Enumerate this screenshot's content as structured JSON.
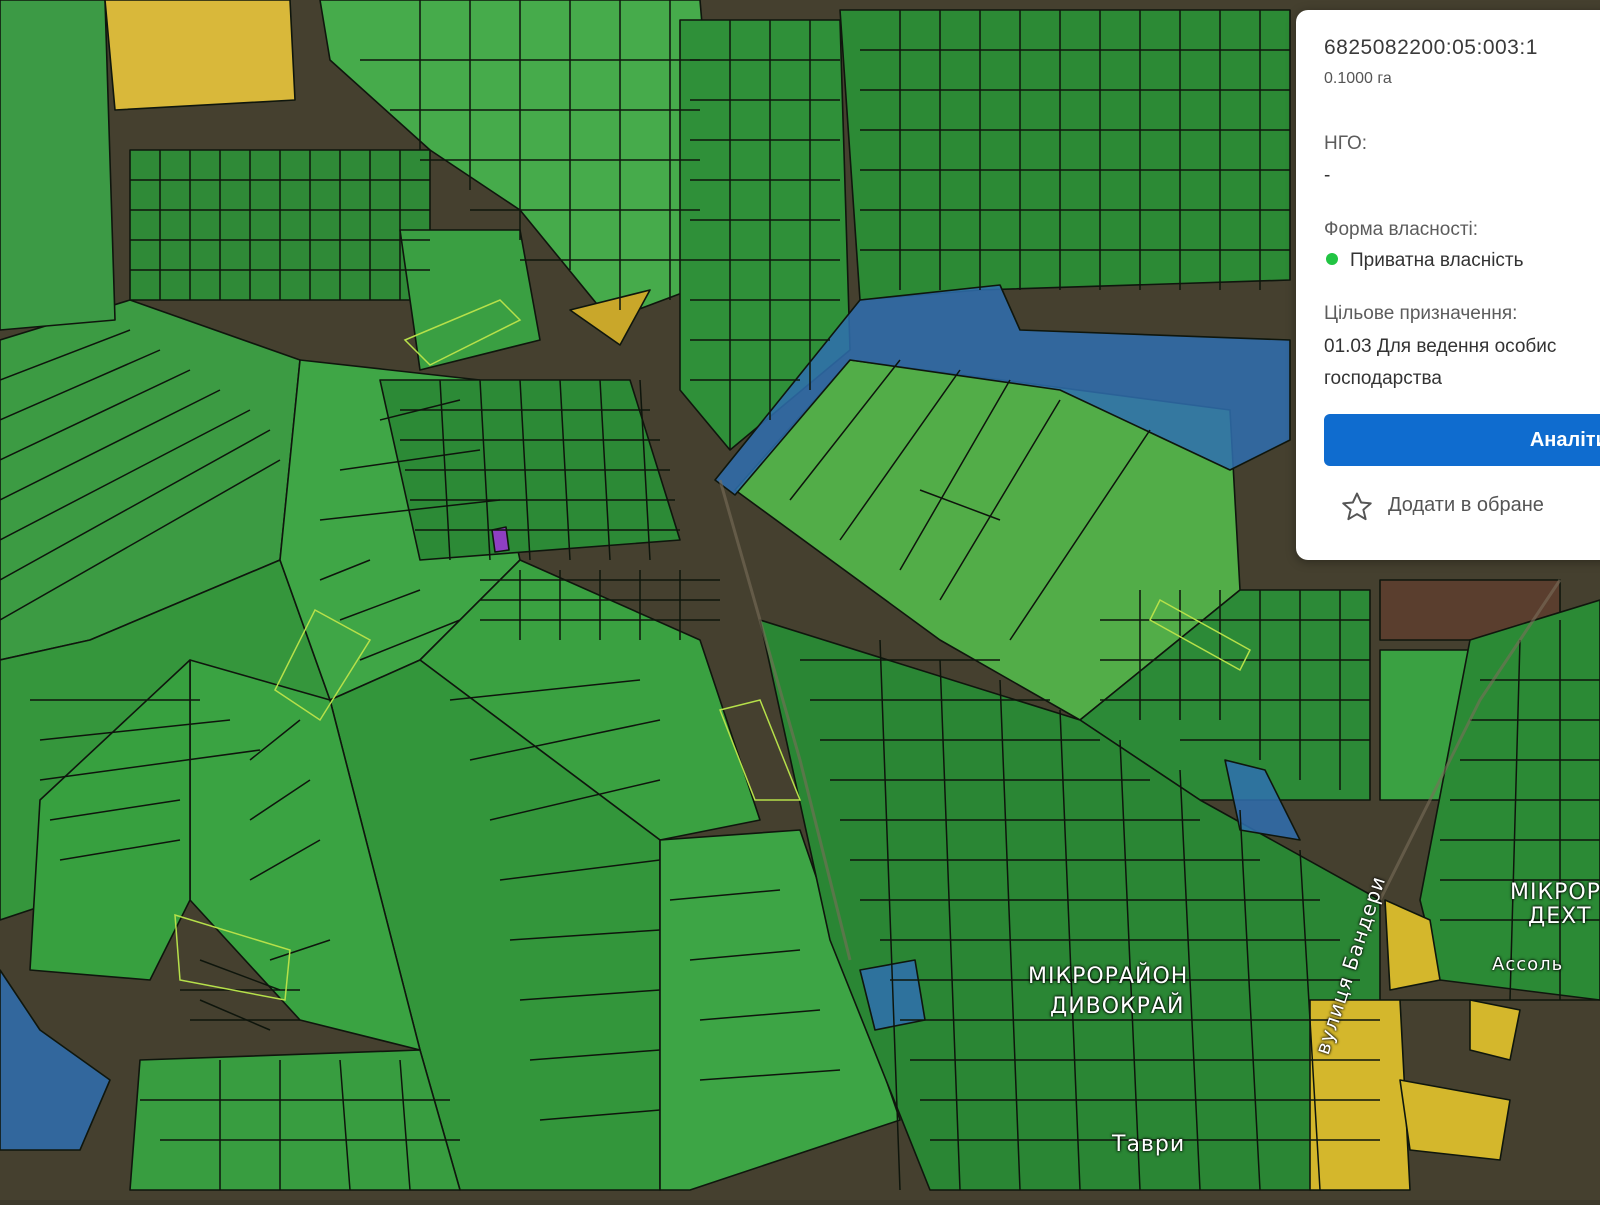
{
  "map": {
    "labels": {
      "district": "МІКРОРАЙОН",
      "district_sub": "ДИВОКРАЙ",
      "street": "вулиця Бандери",
      "district_right": "МІКРОР",
      "district_right_sub": "ДЕХТ",
      "street_bottom": "Таври",
      "poi": "Ассоль"
    },
    "colors": {
      "private": "#2ea33e",
      "state": "#2f6fb0",
      "communal": "#d4b72c",
      "other": "#8e3fc2"
    }
  },
  "parcel_card": {
    "cadastral_number": "6825082200:05:003:1",
    "area": "0.1000 га",
    "ngo_label": "НГО:",
    "ngo_value": "-",
    "ownership_label": "Форма власності:",
    "ownership_value": "Приватна власність",
    "ownership_color": "#21c443",
    "purpose_label": "Цільове призначення:",
    "purpose_value_line1": "01.03 Для ведення особис",
    "purpose_value_line2": "господарства",
    "analytics_button": "Аналітика",
    "favorite_label": "Додати в обране",
    "favorite_icon": "star-icon"
  }
}
